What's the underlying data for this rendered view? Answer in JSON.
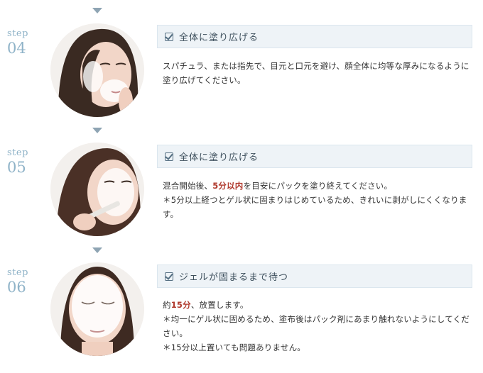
{
  "steps": [
    {
      "word": "step",
      "number": "04",
      "title": "全体に塗り広げる",
      "lines": [
        [
          "スパチュラ、または指先で、目元と口元を避け、顔全体に均等な厚みになるように塗り広げてください。"
        ]
      ]
    },
    {
      "word": "step",
      "number": "05",
      "title": "全体に塗り広げる",
      "lines": [
        [
          "混合開始後、",
          "5分以内",
          "を目安にパックを塗り終えてください。"
        ],
        [
          "＊5分以上経つとゲル状に固まりはじめているため、きれいに剥がしにくくなります。"
        ]
      ]
    },
    {
      "word": "step",
      "number": "06",
      "title": "ジェルが固まるまで待つ",
      "lines": [
        [
          "約",
          "15分",
          "、放置します。"
        ],
        [
          "＊均一にゲル状に固めるため、塗布後はパック剤にあまり触れないようにしてください。"
        ],
        [
          "＊15分以上置いても問題ありません。"
        ]
      ]
    }
  ],
  "colors": {
    "accent_red": "#b03a2e",
    "step_label": "#8fb3c8",
    "title_bg": "#eef3f7"
  }
}
